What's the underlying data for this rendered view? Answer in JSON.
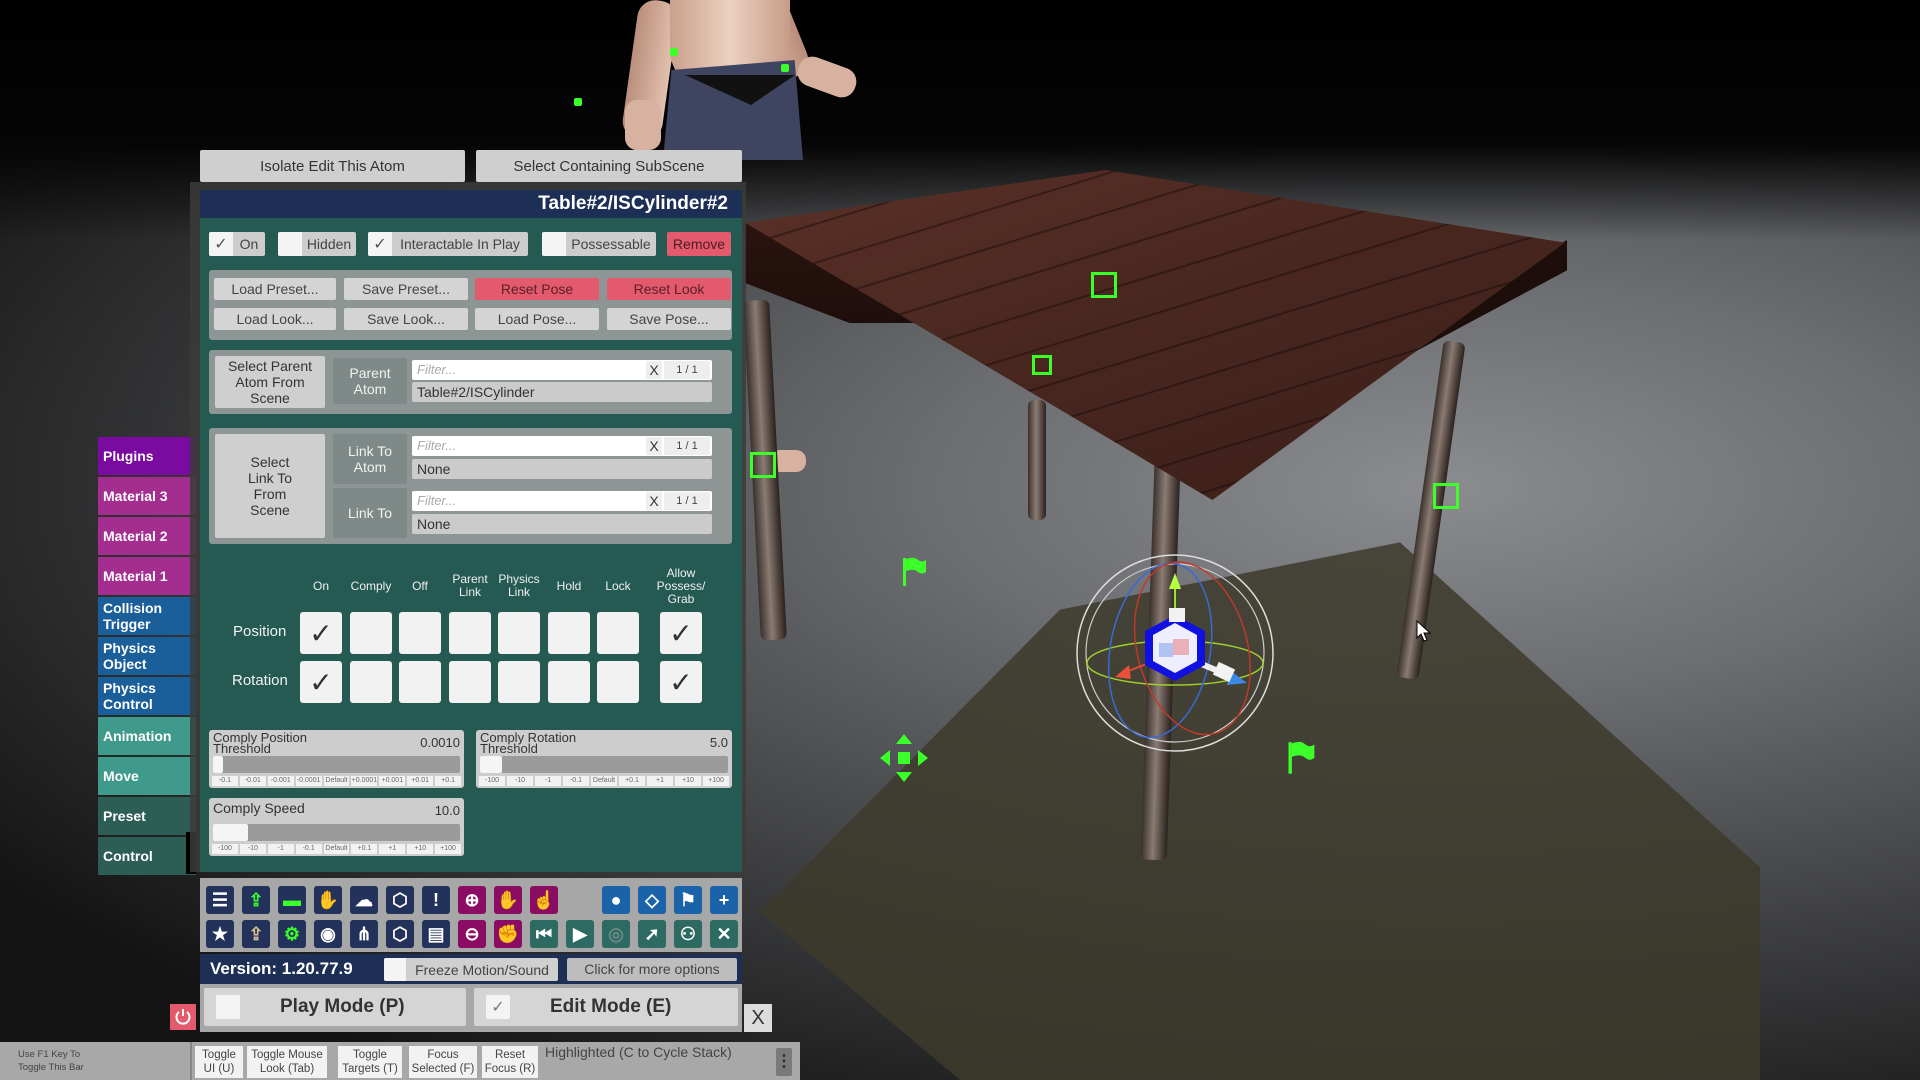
{
  "scene": {
    "selected_atom": "Table#2/ISCylinder#2",
    "gizmo": "translate-rotate-gizmo",
    "markers": [
      "control-anchor",
      "control-anchor",
      "control-anchor",
      "control-anchor",
      "control-anchor",
      "flag-marker",
      "flag-marker",
      "move-arrows-marker"
    ]
  },
  "top_buttons": {
    "isolate": "Isolate Edit This Atom",
    "select_subscene": "Select Containing SubScene"
  },
  "panel": {
    "title": "Table#2/ISCylinder#2",
    "toggles": [
      {
        "label": "On",
        "checked": true
      },
      {
        "label": "Hidden",
        "checked": false
      },
      {
        "label": "Interactable In Play",
        "checked": true
      },
      {
        "label": "Possessable",
        "checked": false
      }
    ],
    "remove_label": "Remove",
    "preset_buttons": [
      "Load Preset...",
      "Save Preset...",
      "Reset Pose",
      "Reset Look",
      "Load Look...",
      "Save Look...",
      "Load Pose...",
      "Save Pose..."
    ],
    "parent": {
      "select_label": "Select Parent Atom From Scene",
      "field_label": "Parent Atom",
      "filter_placeholder": "Filter...",
      "clear": "X",
      "count": "1 / 1",
      "value": "Table#2/ISCylinder"
    },
    "link": {
      "select_label": "Select Link To From Scene",
      "atom_label": "Link To Atom",
      "atom_filter_placeholder": "Filter...",
      "atom_clear": "X",
      "atom_count": "1 / 1",
      "atom_value": "None",
      "link_label": "Link To",
      "link_filter_placeholder": "Filter...",
      "link_clear": "X",
      "link_count": "1 / 1",
      "link_value": "None"
    },
    "state_table": {
      "columns": [
        "On",
        "Comply",
        "Off",
        "Parent Link",
        "Physics Link",
        "Hold",
        "Lock",
        "Allow Possess/ Grab"
      ],
      "rows": [
        {
          "label": "Position",
          "state": "On",
          "allow_possess": true
        },
        {
          "label": "Rotation",
          "state": "On",
          "allow_possess": true
        }
      ]
    },
    "sliders": [
      {
        "label": "Comply Position Threshold",
        "value": "0.0010",
        "fraction": 0.0,
        "steps": [
          "-0.1",
          "-0.01",
          "-0.001",
          "-0.0001",
          "Default",
          "+0.0001",
          "+0.001",
          "+0.01",
          "+0.1"
        ]
      },
      {
        "label": "Comply Rotation Threshold",
        "value": "5.0",
        "fraction": 0.05,
        "steps": [
          "-100",
          "-10",
          "-1",
          "-0.1",
          "Default",
          "+0.1",
          "+1",
          "+10",
          "+100"
        ]
      },
      {
        "label": "Comply Speed",
        "value": "10.0",
        "fraction": 0.1,
        "steps": [
          "-100",
          "-10",
          "-1",
          "-0.1",
          "Default",
          "+0.1",
          "+1",
          "+10",
          "+100"
        ]
      }
    ]
  },
  "tabs": [
    {
      "label": "Plugins",
      "color": "#7a0aa0"
    },
    {
      "label": "Material 3",
      "color": "#a32e8f"
    },
    {
      "label": "Material 2",
      "color": "#a32e8f"
    },
    {
      "label": "Material 1",
      "color": "#a32e8f"
    },
    {
      "label": "Collision Trigger",
      "color": "#1a5e9a"
    },
    {
      "label": "Physics Object",
      "color": "#1a5e9a"
    },
    {
      "label": "Physics Control",
      "color": "#1a5e9a"
    },
    {
      "label": "Animation",
      "color": "#3f9a8c"
    },
    {
      "label": "Move",
      "color": "#3f9a8c"
    },
    {
      "label": "Preset",
      "color": "#2d5e56"
    },
    {
      "label": "Control",
      "color": "#2d5e56"
    }
  ],
  "toolbar": {
    "row1": [
      "menu-icon",
      "open-scene-icon",
      "folder-icon",
      "red-thumb-icon",
      "cloud-download-icon",
      "cube-icon",
      "alert-icon",
      "add-person-icon",
      "hand-icon",
      "pointer-hand-icon",
      "person-icon",
      "unity-icon",
      "flag-icon",
      "plus-icon"
    ],
    "row2": [
      "star-icon",
      "open-folder-icon",
      "folder-settings-icon",
      "camera-icon",
      "share-nodes-icon",
      "package-icon",
      "document-icon",
      "remove-person-icon",
      "grab-hand-icon",
      "skip-back-icon",
      "play-icon",
      "target-icon",
      "cursor-icon",
      "people-icon",
      "tools-icon"
    ]
  },
  "version": "Version: 1.20.77.9",
  "freeze_label": "Freeze Motion/Sound",
  "freeze_checked": false,
  "more_options": "Click for more options",
  "play_mode": {
    "label": "Play Mode (P)",
    "checked": false
  },
  "edit_mode": {
    "label": "Edit Mode (E)",
    "checked": true
  },
  "close_label": "X",
  "bottom_bar": {
    "hint": "Use F1 Key To Toggle This Bar",
    "buttons": [
      "Toggle UI (U)",
      "Toggle Mouse Look (Tab)",
      "Toggle Targets (T)",
      "Focus Selected (F)",
      "Reset Focus (R)"
    ],
    "highlighted": "Highlighted (C to Cycle Stack)",
    "menu": "⋮"
  }
}
